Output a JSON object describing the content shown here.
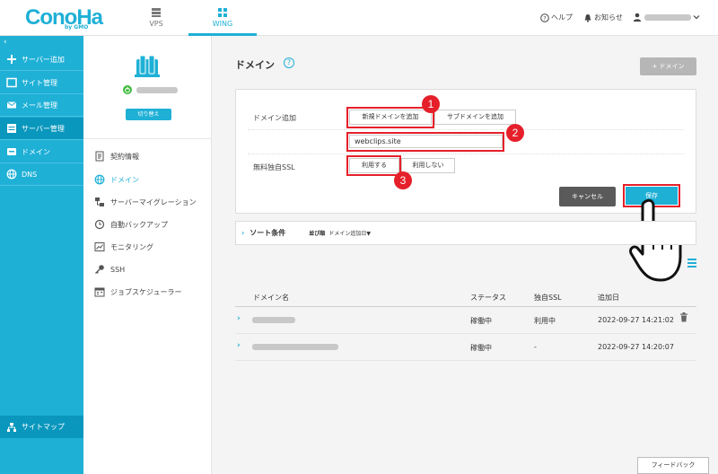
{
  "header": {
    "logo": "ConoHa",
    "logo_sub": "by GMO",
    "tabs": [
      {
        "label": "VPS"
      },
      {
        "label": "WING"
      }
    ],
    "help": "ヘルプ",
    "notice": "お知らせ"
  },
  "sidebar": {
    "items": [
      {
        "label": "サーバー追加"
      },
      {
        "label": "サイト管理"
      },
      {
        "label": "メール管理"
      },
      {
        "label": "サーバー管理"
      },
      {
        "label": "ドメイン"
      },
      {
        "label": "DNS"
      }
    ],
    "sitemap": "サイトマップ"
  },
  "subpanel": {
    "switch_button": "切り替え",
    "items": [
      {
        "label": "契約情報"
      },
      {
        "label": "ドメイン"
      },
      {
        "label": "サーバーマイグレーション"
      },
      {
        "label": "自動バックアップ"
      },
      {
        "label": "モニタリング"
      },
      {
        "label": "SSH"
      },
      {
        "label": "ジョブスケジューラー"
      }
    ]
  },
  "main": {
    "title": "ドメイン",
    "add_button": "+ ドメイン",
    "form": {
      "domain_add_label": "ドメイン追加",
      "new_domain_option": "新規ドメインを追加",
      "subdomain_option": "サブドメインを追加",
      "domain_value": "webclips.site",
      "ssl_label": "無料独自SSL",
      "ssl_use": "利用する",
      "ssl_not_use": "利用しない",
      "cancel": "キャンセル",
      "save": "保存"
    },
    "badges": [
      "1",
      "2",
      "3"
    ],
    "sort": {
      "label": "ソート条件",
      "key": "並び順",
      "value": "ドメイン追加日▼"
    },
    "table": {
      "headers": [
        "ドメイン名",
        "ステータス",
        "独自SSL",
        "追加日"
      ],
      "rows": [
        {
          "status": "稼働中",
          "ssl": "利用中",
          "date": "2022-09-27 14:21:02"
        },
        {
          "status": "稼働中",
          "ssl": "-",
          "date": "2022-09-27 14:20:07"
        }
      ]
    },
    "feedback": "フィードバック"
  },
  "colors": {
    "accent": "#1fb0d6",
    "highlight": "#e5202a",
    "cancel": "#5a5a5a"
  }
}
